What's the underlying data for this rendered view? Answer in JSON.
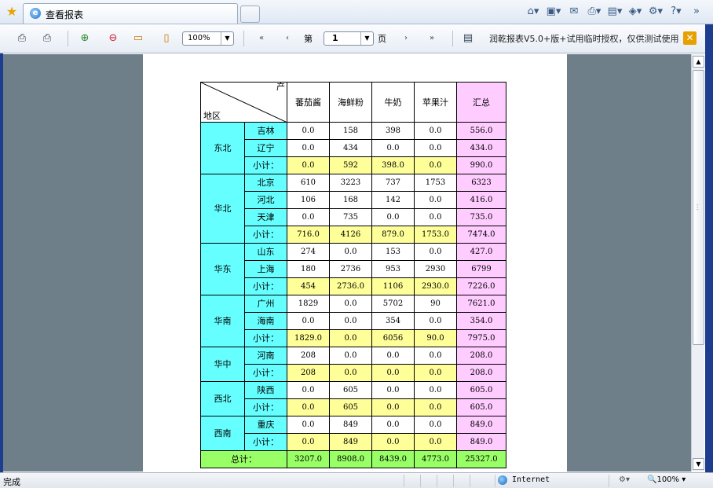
{
  "browser": {
    "tab_title": "查看报表",
    "command_icons": [
      "home-icon",
      "feeds-icon",
      "mail-icon",
      "print-icon",
      "page-icon",
      "safety-icon",
      "tools-icon",
      "help-icon"
    ]
  },
  "toolbar": {
    "zoom": "100%",
    "page_prefix": "第",
    "page_number": "1",
    "page_suffix": "页",
    "license_text": "润乾报表V5.0+版+试用临时授权，仅供测试使用"
  },
  "status": {
    "text": "完成",
    "zone": "Internet",
    "zoom": "100%"
  },
  "colors": {
    "region": "#66ffff",
    "data": "#ffffff",
    "subtotal": "#ffff99",
    "summary": "#ffccff",
    "total": "#99ff66"
  },
  "report": {
    "corner_top": "产",
    "corner_bottom": "地区",
    "headers": [
      "蕃茄酱",
      "海鲜粉",
      "牛奶",
      "苹果汁",
      "汇总"
    ],
    "groups": [
      {
        "name": "东北",
        "rows": [
          {
            "city": "吉林",
            "v": [
              "0.0",
              "158",
              "398",
              "0.0",
              "556.0"
            ]
          },
          {
            "city": "辽宁",
            "v": [
              "0.0",
              "434",
              "0.0",
              "0.0",
              "434.0"
            ]
          },
          {
            "city": "小计：",
            "subtotal": true,
            "v": [
              "0.0",
              "592",
              "398.0",
              "0.0",
              "990.0"
            ]
          }
        ]
      },
      {
        "name": "华北",
        "rows": [
          {
            "city": "北京",
            "v": [
              "610",
              "3223",
              "737",
              "1753",
              "6323"
            ]
          },
          {
            "city": "河北",
            "v": [
              "106",
              "168",
              "142",
              "0.0",
              "416.0"
            ]
          },
          {
            "city": "天津",
            "v": [
              "0.0",
              "735",
              "0.0",
              "0.0",
              "735.0"
            ]
          },
          {
            "city": "小计：",
            "subtotal": true,
            "v": [
              "716.0",
              "4126",
              "879.0",
              "1753.0",
              "7474.0"
            ]
          }
        ]
      },
      {
        "name": "华东",
        "rows": [
          {
            "city": "山东",
            "v": [
              "274",
              "0.0",
              "153",
              "0.0",
              "427.0"
            ]
          },
          {
            "city": "上海",
            "v": [
              "180",
              "2736",
              "953",
              "2930",
              "6799"
            ]
          },
          {
            "city": "小计：",
            "subtotal": true,
            "v": [
              "454",
              "2736.0",
              "1106",
              "2930.0",
              "7226.0"
            ]
          }
        ]
      },
      {
        "name": "华南",
        "rows": [
          {
            "city": "广州",
            "v": [
              "1829",
              "0.0",
              "5702",
              "90",
              "7621.0"
            ]
          },
          {
            "city": "海南",
            "v": [
              "0.0",
              "0.0",
              "354",
              "0.0",
              "354.0"
            ]
          },
          {
            "city": "小计：",
            "subtotal": true,
            "v": [
              "1829.0",
              "0.0",
              "6056",
              "90.0",
              "7975.0"
            ]
          }
        ]
      },
      {
        "name": "华中",
        "rows": [
          {
            "city": "河南",
            "v": [
              "208",
              "0.0",
              "0.0",
              "0.0",
              "208.0"
            ]
          },
          {
            "city": "小计：",
            "subtotal": true,
            "v": [
              "208",
              "0.0",
              "0.0",
              "0.0",
              "208.0"
            ]
          }
        ]
      },
      {
        "name": "西北",
        "rows": [
          {
            "city": "陕西",
            "v": [
              "0.0",
              "605",
              "0.0",
              "0.0",
              "605.0"
            ]
          },
          {
            "city": "小计：",
            "subtotal": true,
            "v": [
              "0.0",
              "605",
              "0.0",
              "0.0",
              "605.0"
            ]
          }
        ]
      },
      {
        "name": "西南",
        "rows": [
          {
            "city": "重庆",
            "v": [
              "0.0",
              "849",
              "0.0",
              "0.0",
              "849.0"
            ]
          },
          {
            "city": "小计：",
            "subtotal": true,
            "v": [
              "0.0",
              "849",
              "0.0",
              "0.0",
              "849.0"
            ]
          }
        ]
      }
    ],
    "total_label": "总计：",
    "total": [
      "3207.0",
      "8908.0",
      "8439.0",
      "4773.0",
      "25327.0"
    ]
  }
}
